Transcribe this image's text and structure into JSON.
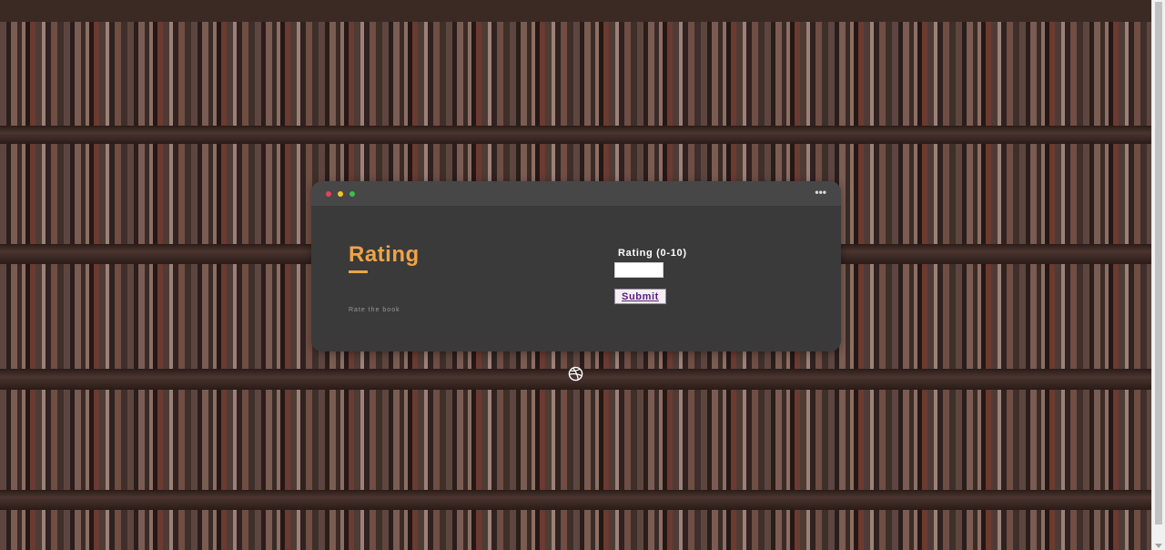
{
  "window": {
    "title": "Rating",
    "subtitle": "Rate the book",
    "menu_icon": "more-horizontal-icon",
    "dots": {
      "red": "#e0435a",
      "yellow": "#f2c524",
      "green": "#3fbf4a"
    }
  },
  "form": {
    "label": "Rating (0-10)",
    "input_value": "",
    "submit_label": "Submit"
  },
  "footer": {
    "icon": "dribbble-icon"
  },
  "colors": {
    "accent": "#f0a346",
    "submit_text": "#5c1a7a",
    "window_bg": "#3a3a3a",
    "titlebar_bg": "#474748"
  }
}
